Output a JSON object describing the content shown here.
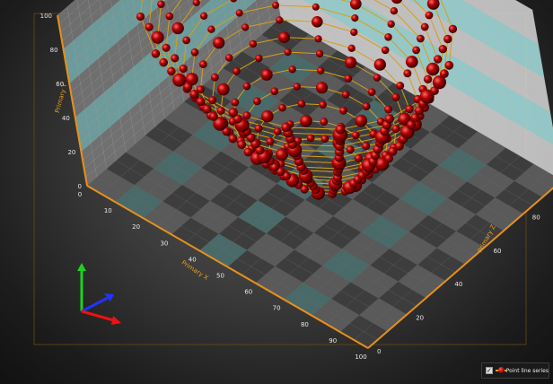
{
  "chart_data": {
    "type": "scatter",
    "subtype": "3d-point-line",
    "x_axis": {
      "title": "Primary X",
      "range": [
        0,
        100
      ],
      "ticks": [
        "0",
        "10",
        "20",
        "30",
        "40",
        "50",
        "60",
        "70",
        "80",
        "90",
        "100"
      ]
    },
    "y_axis": {
      "title": "Primary Y",
      "range": [
        0,
        100
      ],
      "ticks": [
        "0",
        "20",
        "40",
        "60",
        "80",
        "100"
      ]
    },
    "z_axis": {
      "title": "Primary Z",
      "range": [
        0,
        100
      ],
      "ticks": [
        "0",
        "20",
        "40",
        "60",
        "80",
        "100"
      ]
    },
    "series": [
      {
        "name": "Point line series",
        "line_color": "#d4a017",
        "point_color": "#b00000",
        "structure": "concentric rings (paraboloid bowl), ring radius grows with height",
        "rings": [
          {
            "y": 10,
            "radius": 12
          },
          {
            "y": 16,
            "radius": 15
          },
          {
            "y": 22,
            "radius": 18
          },
          {
            "y": 28,
            "radius": 21
          },
          {
            "y": 34,
            "radius": 24
          },
          {
            "y": 40,
            "radius": 27
          },
          {
            "y": 46,
            "radius": 29
          },
          {
            "y": 52,
            "radius": 32
          },
          {
            "y": 58,
            "radius": 34
          },
          {
            "y": 64,
            "radius": 36
          },
          {
            "y": 70,
            "radius": 38
          },
          {
            "y": 76,
            "radius": 40
          },
          {
            "y": 82,
            "radius": 42
          },
          {
            "y": 88,
            "radius": 44
          },
          {
            "y": 94,
            "radius": 46
          }
        ],
        "center": {
          "x": 50,
          "z": 50
        },
        "points_per_ring": 18
      }
    ],
    "bands_color": "#6ad0d0",
    "legend_position": "bottom-right",
    "grid": true
  },
  "legend": {
    "label": "Point line series",
    "checked": true
  }
}
